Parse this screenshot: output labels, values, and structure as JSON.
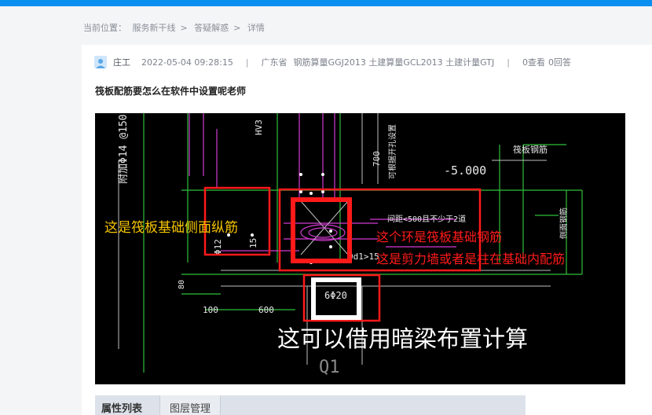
{
  "breadcrumb": {
    "label": "当前位置：",
    "items": [
      "服务新干线",
      "答疑解惑",
      "详情"
    ],
    "separator": ">"
  },
  "post": {
    "author": "庄工",
    "time": "2022-05-04 09:28:15",
    "divider": "|",
    "province": "广东省",
    "software": "钢筋算量GGJ2013 土建算量GCL2013 土建计量GTJ",
    "views": "0查看",
    "answers": "0回答",
    "title": "筏板配筋要怎么在软件中设置呢老师"
  },
  "image": {
    "annotations": {
      "side_bars": "这是筏板基础侧面纵筋",
      "raft_rebar": "这个环是筏板基础钢筋",
      "wall_rebar": "这是剪力墙或者是柱在基础内配筋",
      "hidden_beam": "这可以借用暗梁布置计算"
    },
    "cad_text": {
      "rebar_left": "附加Φ14 @150",
      "hv": "HV3",
      "dim_700": "700",
      "note": "可根据开孔设置",
      "elev": "-5.000",
      "raft_label": "筏板钢筋",
      "spacing": "间距<500且不少于2道",
      "rebar_20": "6Φ20",
      "dim_100": "100",
      "dim_600": "600",
      "dim_80": "80",
      "q1": "Q1",
      "side": "侧面钢筋",
      "phi12": "Φ12",
      "n15": "15",
      "od1": "0d1>15"
    },
    "colors": {
      "annotation_red": "#ff1a1a",
      "annotation_yellow": "#f5c400",
      "annotation_white": "#ffffff",
      "cad_green": "#2fbf3a",
      "cad_magenta": "#d23bd2",
      "cad_gray": "#bfbfbf"
    }
  },
  "bottom_tabs": [
    "属性列表",
    "图层管理"
  ],
  "colors": {
    "topbar": "#0a8ff0",
    "page_bg": "#f4f5f7",
    "card_bg": "#ffffff"
  }
}
